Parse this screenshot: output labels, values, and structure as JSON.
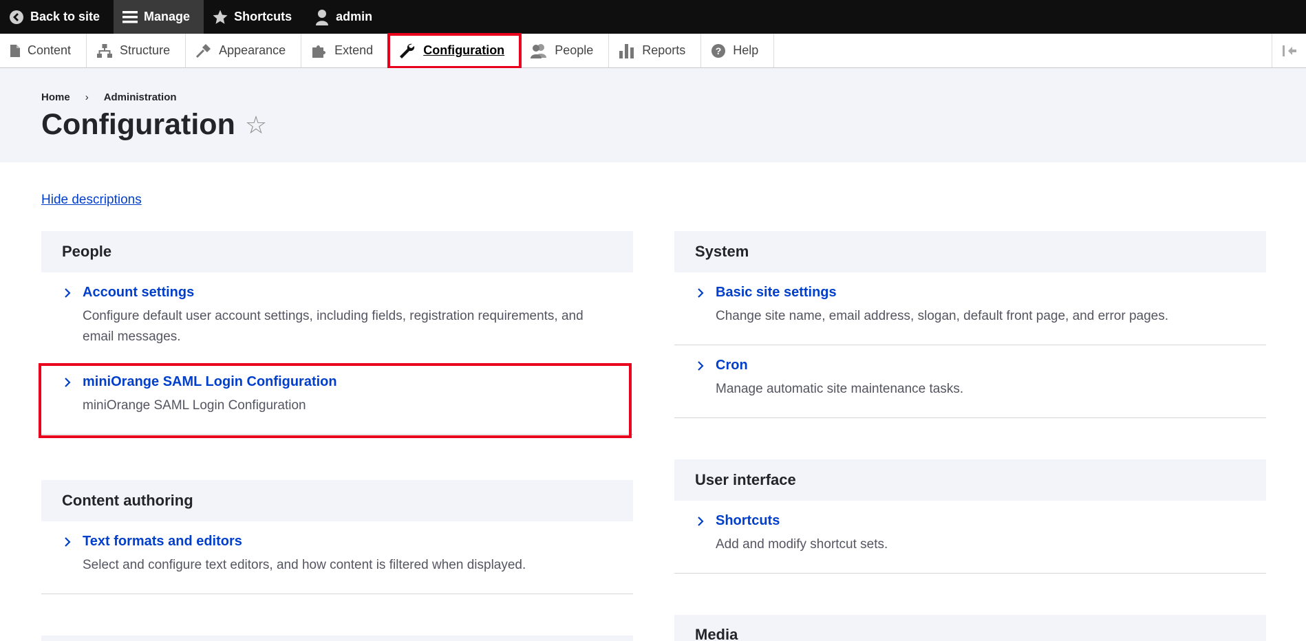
{
  "toolbar": {
    "back_label": "Back to site",
    "manage_label": "Manage",
    "shortcuts_label": "Shortcuts",
    "user_label": "admin"
  },
  "tray": {
    "items": [
      {
        "label": "Content",
        "icon": "file-icon"
      },
      {
        "label": "Structure",
        "icon": "sitemap-icon"
      },
      {
        "label": "Appearance",
        "icon": "brush-icon"
      },
      {
        "label": "Extend",
        "icon": "puzzle-icon"
      },
      {
        "label": "Configuration",
        "icon": "wrench-icon",
        "active": true
      },
      {
        "label": "People",
        "icon": "people-icon"
      },
      {
        "label": "Reports",
        "icon": "bar-chart-icon"
      },
      {
        "label": "Help",
        "icon": "help-icon"
      }
    ]
  },
  "breadcrumb": {
    "home": "Home",
    "separator": "›",
    "admin": "Administration"
  },
  "page": {
    "title": "Configuration",
    "star": "☆",
    "hide_descriptions": "Hide descriptions"
  },
  "sections": {
    "people": {
      "title": "People",
      "items": [
        {
          "label": "Account settings",
          "desc": "Configure default user account settings, including fields, registration requirements, and email messages."
        },
        {
          "label": "miniOrange SAML Login Configuration",
          "desc": "miniOrange SAML Login Configuration"
        }
      ]
    },
    "content_authoring": {
      "title": "Content authoring",
      "items": [
        {
          "label": "Text formats and editors",
          "desc": "Select and configure text editors, and how content is filtered when displayed."
        }
      ]
    },
    "system": {
      "title": "System",
      "items": [
        {
          "label": "Basic site settings",
          "desc": "Change site name, email address, slogan, default front page, and error pages."
        },
        {
          "label": "Cron",
          "desc": "Manage automatic site maintenance tasks."
        }
      ]
    },
    "user_interface": {
      "title": "User interface",
      "items": [
        {
          "label": "Shortcuts",
          "desc": "Add and modify shortcut sets."
        }
      ]
    },
    "media": {
      "title": "Media"
    }
  },
  "colors": {
    "link": "#003ecc",
    "highlight": "#e8001c",
    "toolbar_bg": "#0f0f0f",
    "header_bg": "#f3f4f9"
  }
}
